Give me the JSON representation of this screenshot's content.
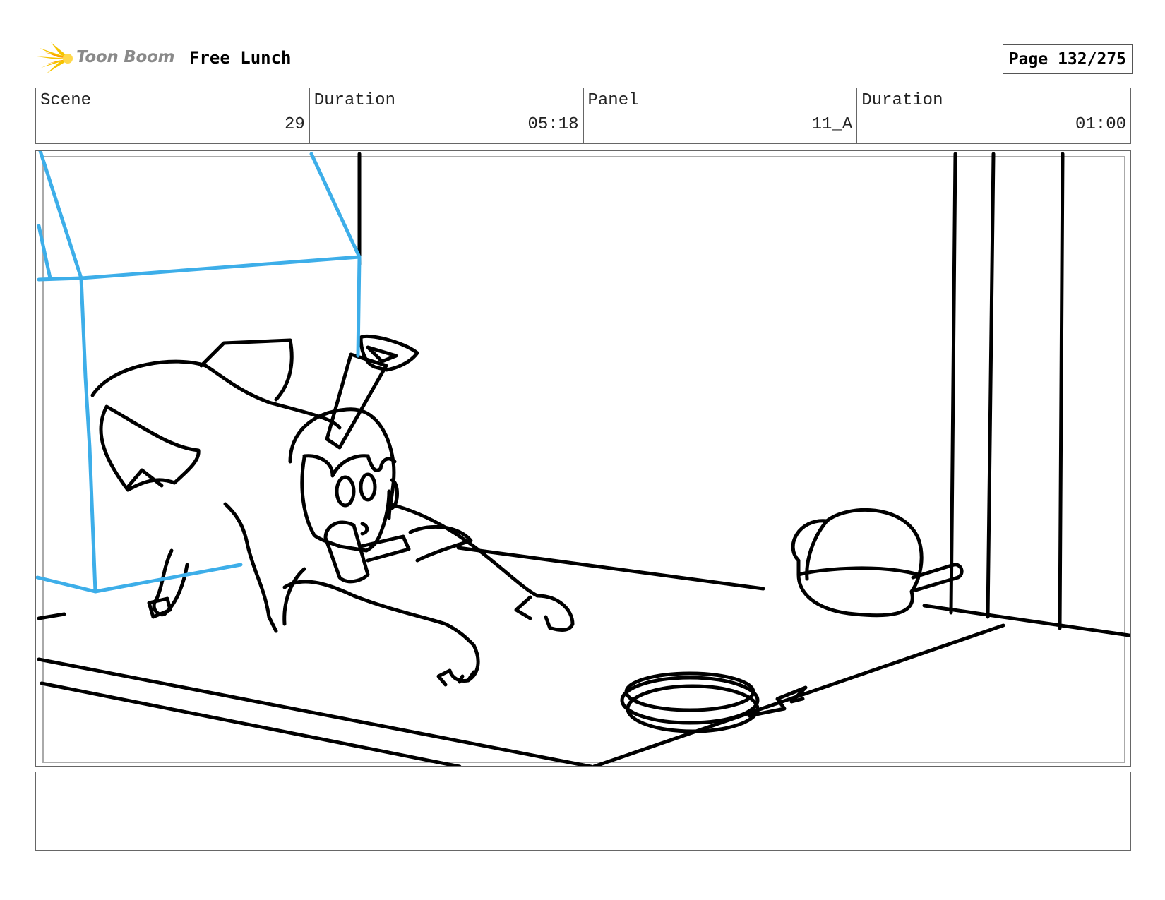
{
  "header": {
    "logo_text": "Toon Boom",
    "logo_icon": "starburst-icon",
    "project_title": "Free Lunch",
    "page_indicator": "Page 132/275"
  },
  "info": {
    "scene_label": "Scene",
    "scene_value": "29",
    "scene_duration_label": "Duration",
    "scene_duration_value": "05:18",
    "panel_label": "Panel",
    "panel_value": "11_A",
    "panel_duration_label": "Duration",
    "panel_duration_value": "01:00"
  },
  "colors": {
    "sketch_line": "#000000",
    "box_layer": "#3daee9",
    "logo_accent": "#f5c400",
    "frame_border": "#666666"
  },
  "notes": {
    "text": ""
  }
}
